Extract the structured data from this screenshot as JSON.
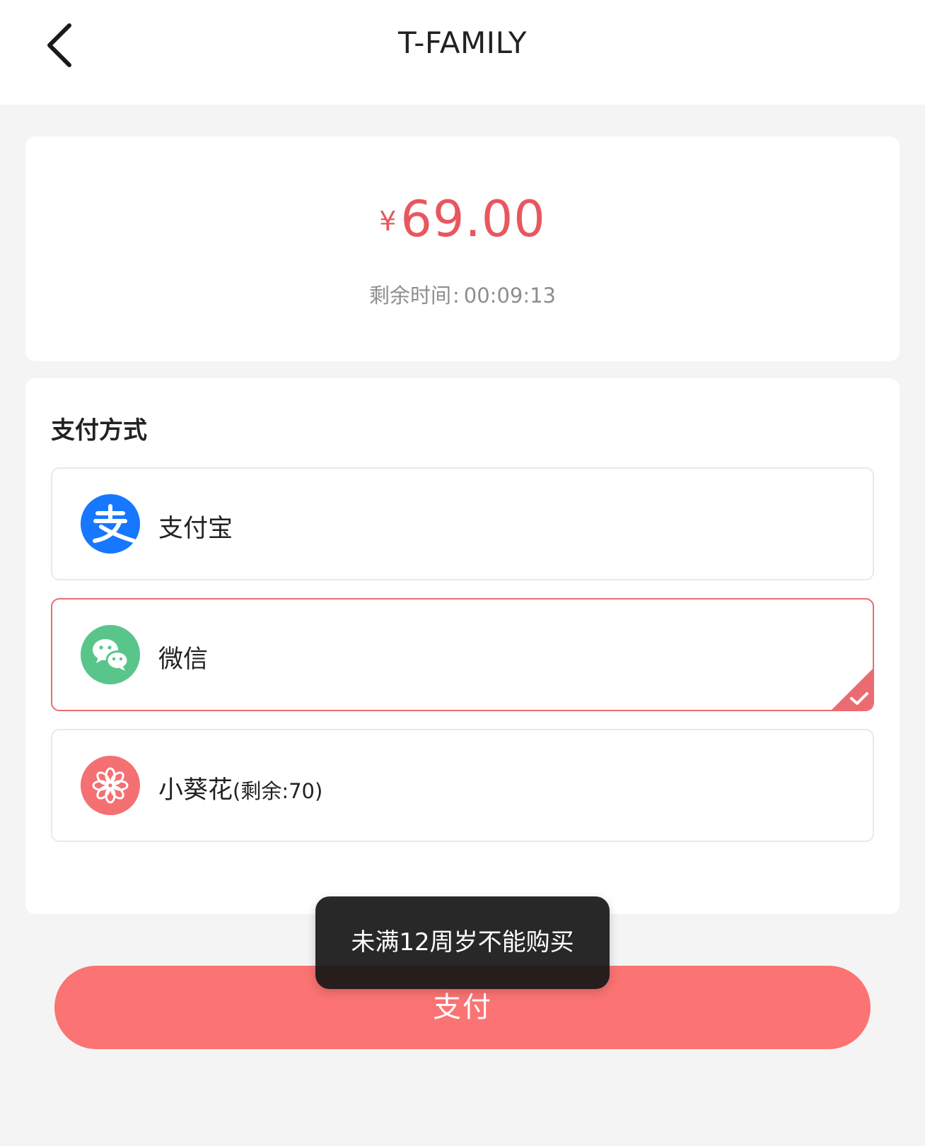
{
  "header": {
    "title": "T-FAMILY",
    "back_icon": "chevron-left-icon"
  },
  "amount": {
    "currency": "¥",
    "value": "69.00",
    "color": "#e8575e"
  },
  "countdown": {
    "label": "剩余时间",
    "separator": ":",
    "time": "00:09:13"
  },
  "payment": {
    "section_title": "支付方式",
    "options": [
      {
        "label": "支付宝",
        "sub": "",
        "icon": "alipay-icon",
        "icon_color": "#1677ff",
        "selected": false
      },
      {
        "label": "微信",
        "sub": "",
        "icon": "wechat-icon",
        "icon_color": "#5ac58a",
        "selected": true
      },
      {
        "label": "小葵花",
        "sub": "(剩余:70)",
        "icon": "flower-icon",
        "icon_color": "#f47072",
        "selected": false
      }
    ],
    "selected_icon": "checkmark-icon",
    "accent_color": "#ea6c70"
  },
  "pay_button": {
    "label": "支付",
    "color": "#fb7373"
  },
  "toast": {
    "message": "未满12周岁不能购买"
  }
}
